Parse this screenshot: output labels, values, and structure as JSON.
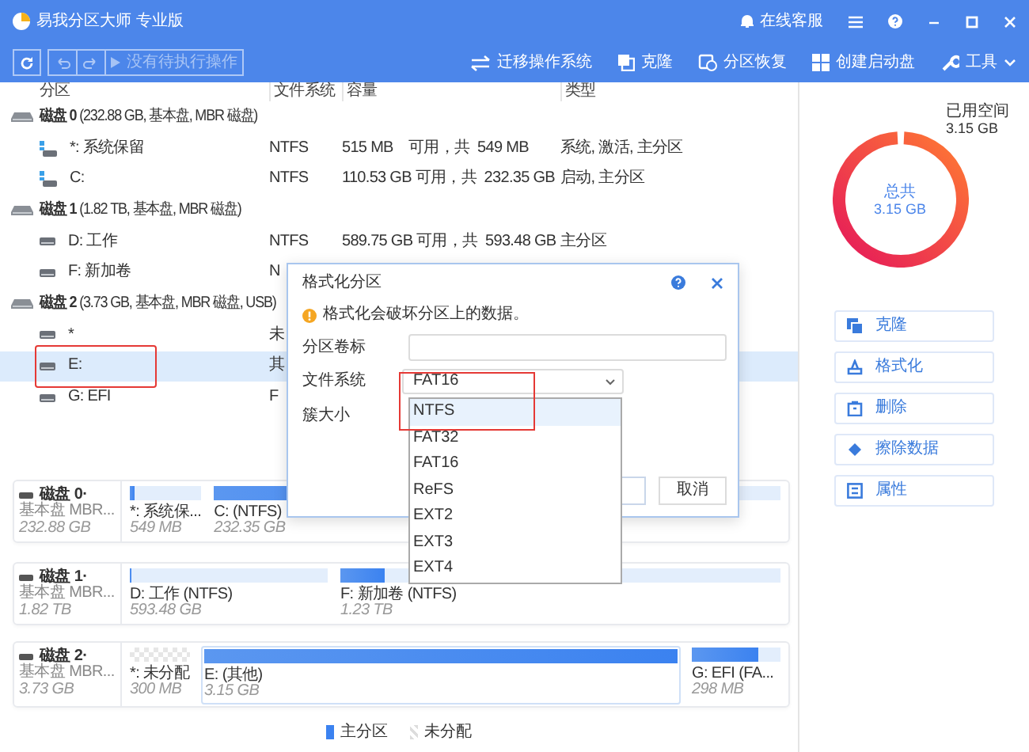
{
  "window": {
    "title": "易我分区大师 专业版",
    "support": "在线客服"
  },
  "toolbar": {
    "pending": {
      "label": "没有待执行操作",
      "disabled": true
    },
    "tools": [
      {
        "kind": "migrate",
        "label": "迁移操作系统"
      },
      {
        "kind": "clone",
        "label": "克隆"
      },
      {
        "kind": "recover",
        "label": "分区恢复"
      },
      {
        "kind": "bootdisk",
        "label": "创建启动盘"
      },
      {
        "kind": "tools",
        "label": "工具"
      }
    ]
  },
  "table": {
    "columns": [
      "分区",
      "文件系统",
      "容量",
      "类型"
    ],
    "rows": [
      {
        "kind": "disk",
        "label": "**磁盘 0** (232.88 GB, 基本盘, MBR 磁盘)"
      },
      {
        "kind": "system",
        "name": "*: 系统保留",
        "fs": "NTFS",
        "capacity": "515 MB    可用，共  549 MB",
        "type": "系统, 激活, 主分区",
        "selected": false,
        "highlighted": false
      },
      {
        "kind": "system",
        "name": "C:",
        "fs": "NTFS",
        "capacity": "110.53 GB 可用，共  232.35 GB",
        "type": "启动, 主分区",
        "selected": false,
        "highlighted": false
      },
      {
        "kind": "disk",
        "label": "**磁盘 1** (1.82 TB, 基本盘, MBR 磁盘)"
      },
      {
        "kind": "partition",
        "name": "D: 工作",
        "fs": "NTFS",
        "capacity": "589.75 GB 可用，共  593.48 GB",
        "type": "主分区",
        "selected": false,
        "highlighted": false
      },
      {
        "kind": "partition",
        "name": "F: 新加卷",
        "fs": "N",
        "selected": false,
        "highlighted": false
      },
      {
        "kind": "disk",
        "label": "**磁盘 2** (3.73 GB, 基本盘, MBR 磁盘, USB)"
      },
      {
        "kind": "partition",
        "name": "*",
        "fs": "未",
        "selected": false,
        "highlighted": false
      },
      {
        "kind": "partition",
        "name": "E:",
        "fs": "其",
        "selected": true,
        "highlighted": true
      },
      {
        "kind": "partition",
        "name": "G: EFI",
        "fs": "F",
        "selected": false,
        "highlighted": false
      }
    ]
  },
  "disk_map": [
    {
      "title": "磁盘 0·",
      "subtitle": "基本盘 MBR...",
      "size": "232.88 GB",
      "partitions": [
        {
          "kind": "used",
          "name": "*: 系统保...",
          "size": "549 MB",
          "level": 0.06,
          "selected": false
        },
        {
          "kind": "used",
          "name": "C:  (NTFS)",
          "size": "232.35 GB",
          "level": 0.52,
          "selected": false
        }
      ]
    },
    {
      "title": "磁盘 1·",
      "subtitle": "基本盘 MBR...",
      "size": "1.82 TB",
      "partitions": [
        {
          "kind": "used",
          "name": "D: 工作 (NTFS)",
          "size": "593.48 GB",
          "level": 0.01,
          "selected": false
        },
        {
          "kind": "used",
          "name": "F: 新加卷 (NTFS)",
          "size": "1.23 TB",
          "level": 0.1,
          "selected": false
        }
      ]
    },
    {
      "title": "磁盘 2·",
      "subtitle": "基本盘 MBR...",
      "size": "3.73 GB",
      "partitions": [
        {
          "kind": "unallocated",
          "name": "*: 未分配",
          "size": "300 MB",
          "selected": false
        },
        {
          "kind": "used",
          "name": "E:  (其他)",
          "size": "3.15 GB",
          "level": 1,
          "selected": true
        },
        {
          "kind": "used",
          "name": "G: EFI (FA...",
          "size": "298 MB",
          "level": 0.75,
          "selected": false
        }
      ]
    }
  ],
  "legend": [
    {
      "kind": "primary",
      "label": "主分区"
    },
    {
      "kind": "unallocated",
      "label": "未分配"
    }
  ],
  "usage": {
    "used_label": "已用空间",
    "used": "3.15 GB",
    "total_label": "总共",
    "total": "3.15 GB"
  },
  "actions": [
    {
      "kind": "clone",
      "label": "克隆"
    },
    {
      "kind": "format",
      "label": "格式化"
    },
    {
      "kind": "delete",
      "label": "删除"
    },
    {
      "kind": "wipe",
      "label": "擦除数据"
    },
    {
      "kind": "properties",
      "label": "属性"
    }
  ],
  "dialog": {
    "title": "格式化分区",
    "warning": "格式化会破坏分区上的数据。",
    "fields": [
      {
        "kind": "text",
        "label": "分区卷标"
      },
      {
        "kind": "select",
        "label": "文件系统",
        "value": "FAT16",
        "highlighted": true
      },
      {
        "kind": "covered",
        "label": "簇大小"
      }
    ],
    "options": [
      {
        "label": "NTFS",
        "selected": true
      },
      {
        "label": "FAT32",
        "selected": false
      },
      {
        "label": "FAT16",
        "selected": false
      },
      {
        "label": "ReFS",
        "selected": false
      },
      {
        "label": "EXT2",
        "selected": false
      },
      {
        "label": "EXT3",
        "selected": false
      },
      {
        "label": "EXT4",
        "selected": false
      }
    ],
    "buttons": [
      {
        "kind": "ok"
      },
      {
        "kind": "cancel",
        "label": "取消"
      }
    ]
  }
}
